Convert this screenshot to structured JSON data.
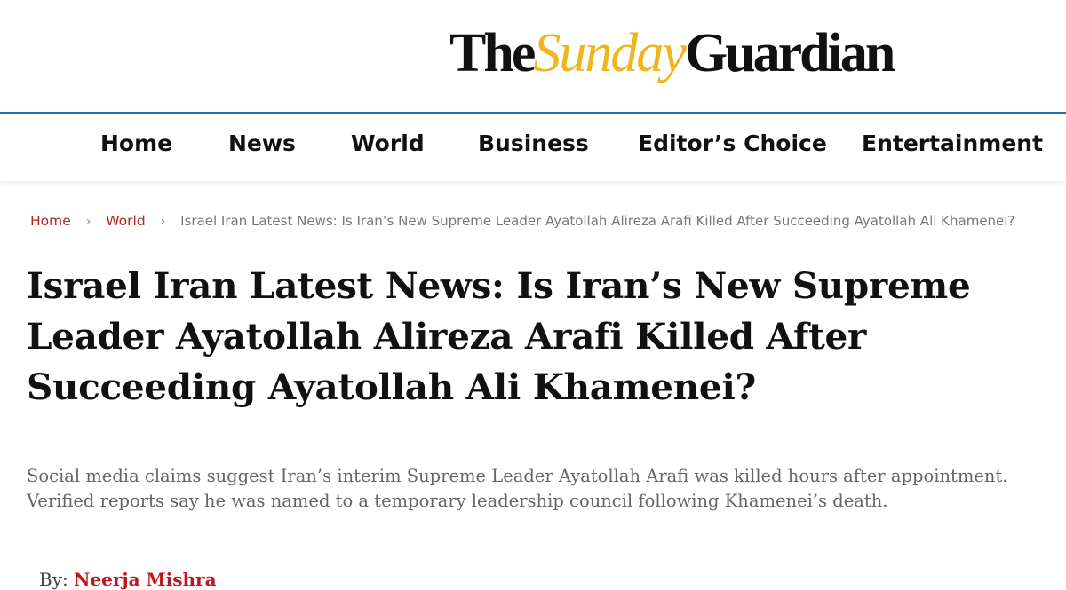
{
  "brand": {
    "logo_the": "The",
    "logo_sunday": "Sunday",
    "logo_guardian": "Guardian"
  },
  "nav": {
    "items": [
      "Home",
      "News",
      "World",
      "Business",
      "Editor’s Choice",
      "Entertainment"
    ]
  },
  "breadcrumb": {
    "home": "Home",
    "section": "World",
    "separator": "›",
    "current": "Israel Iran Latest News: Is Iran’s New Supreme Leader Ayatollah Alireza Arafi Killed After Succeeding Ayatollah Ali Khamenei?"
  },
  "article": {
    "headline": "Israel Iran Latest News: Is Iran’s New Supreme Leader Ayatollah Alireza Arafi Killed After Succeeding Ayatollah Ali Khamenei?",
    "summary": "Social media claims suggest Iran’s interim Supreme Leader Ayatollah Arafi was killed hours after appointment. Verified reports say he was named to a temporary leadership council following Khamenei’s death.",
    "byline_prefix": "By:",
    "author": "Neerja Mishra"
  },
  "colors": {
    "accent_blue": "#1f6fb2",
    "logo_gold": "#f0b41c",
    "link_red": "#b3261e"
  }
}
